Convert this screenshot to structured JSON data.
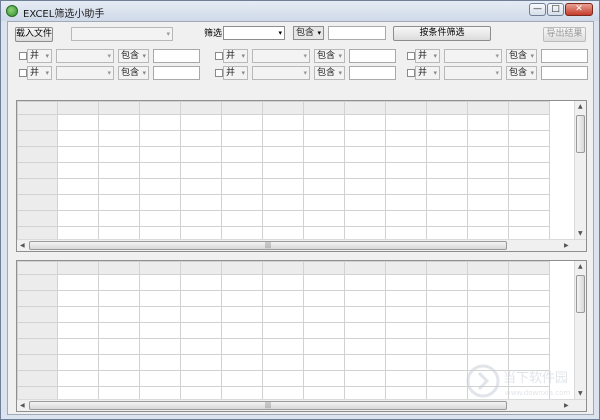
{
  "window": {
    "title": "EXCEL筛选小助手"
  },
  "titlebar_buttons": {
    "minimize": "—",
    "maximize": "□",
    "close": "✕"
  },
  "toolbar": {
    "load_button": "载入文件",
    "filter_label": "筛选",
    "filter_select_value": "",
    "contains_select_value": "包含",
    "filter_input_value": "",
    "condition_filter_button": "按条件筛选",
    "export_button": "导出结果"
  },
  "condition_groups": [
    {
      "row1": {
        "logic": "并",
        "contains": "包含"
      },
      "row2": {
        "logic": "并",
        "contains": "包含"
      }
    },
    {
      "row1": {
        "logic": "并",
        "contains": "包含"
      },
      "row2": {
        "logic": "并",
        "contains": "包含"
      }
    },
    {
      "row1": {
        "logic": "并",
        "contains": "包含"
      },
      "row2": {
        "logic": "并",
        "contains": "包含"
      }
    }
  ],
  "watermark": {
    "text": "当下软件园",
    "url": "www.downxia.com"
  }
}
